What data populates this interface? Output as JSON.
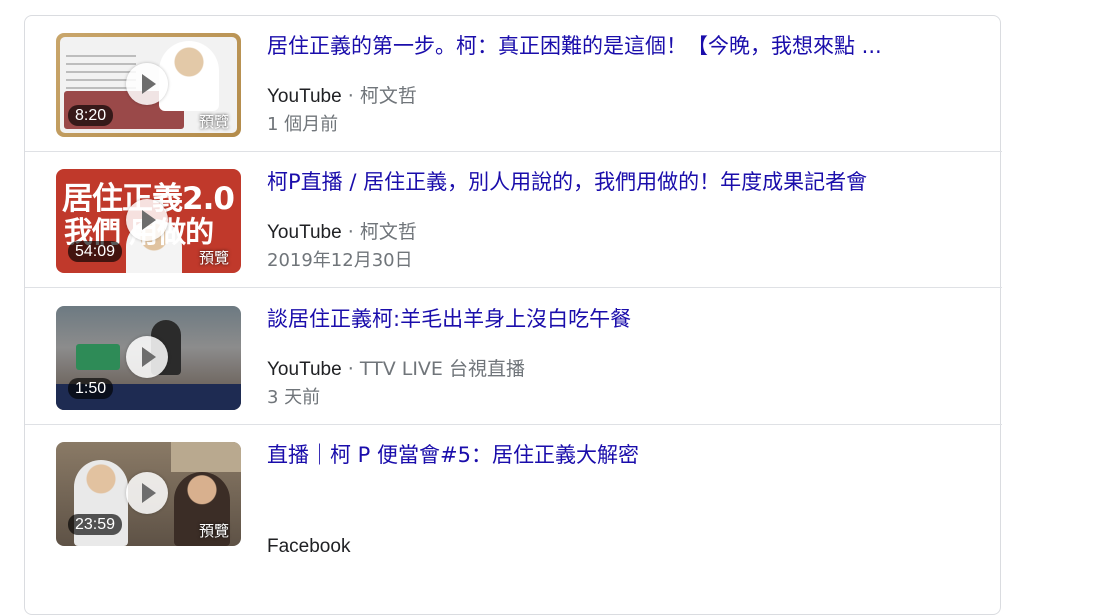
{
  "results": [
    {
      "title": "居住正義的第一步。柯：真正困難的是這個！【今晚，我想來點 ...",
      "site": "YouTube",
      "separator": "·",
      "author": "柯文哲",
      "date": "1 個月前",
      "duration": "8:20",
      "preview_label": "預覽"
    },
    {
      "title": "柯P直播 / 居住正義，別人用說的，我們用做的！年度成果記者會",
      "site": "YouTube",
      "separator": "·",
      "author": "柯文哲",
      "date": "2019年12月30日",
      "duration": "54:09",
      "preview_label": "預覽",
      "thumb_text_1": "居住正義2.0",
      "thumb_text_2": "我們 用做的"
    },
    {
      "title": "談居住正義柯:羊毛出羊身上沒白吃午餐",
      "site": "YouTube",
      "separator": "·",
      "author": "TTV LIVE 台視直播",
      "date": "3 天前",
      "duration": "1:50"
    },
    {
      "title": "直播｜柯 P 便當會#5：居住正義大解密",
      "site": "Facebook",
      "duration": "23:59",
      "preview_label": "預覽"
    }
  ]
}
